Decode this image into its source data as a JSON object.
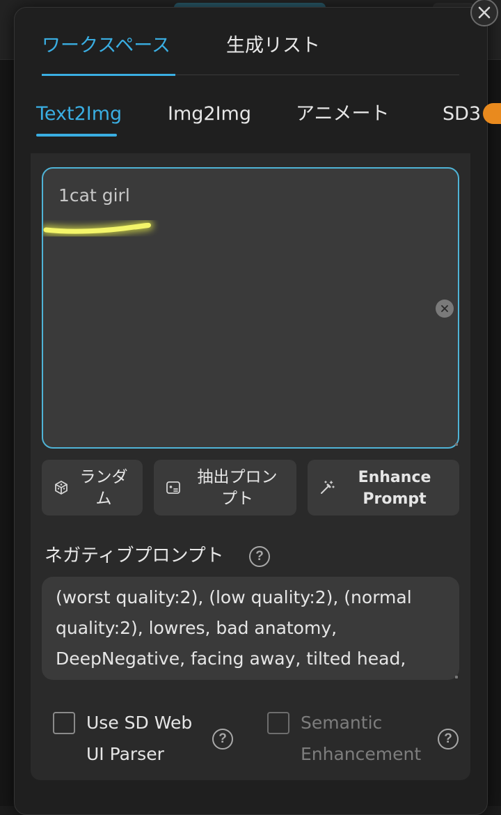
{
  "main_tabs": [
    {
      "label": "ワークスペース",
      "active": true
    },
    {
      "label": "生成リスト",
      "active": false
    }
  ],
  "mode_tabs": [
    {
      "label": "Text2Img",
      "active": true
    },
    {
      "label": "Img2Img",
      "active": false
    },
    {
      "label": "アニメート",
      "active": false
    },
    {
      "label": "SD3",
      "active": false
    }
  ],
  "prompt": {
    "value": "1cat girl"
  },
  "actions": {
    "random": {
      "line1": "ランダ",
      "line2": "ム",
      "icon": "dice-icon"
    },
    "extract": {
      "line1": "抽出プロン",
      "line2": "プト",
      "icon": "image-extract-icon"
    },
    "enhance": {
      "line1": "Enhance",
      "line2": "Prompt",
      "icon": "magic-wand-icon"
    }
  },
  "negative": {
    "title": "ネガティブプロンプト",
    "help": "?",
    "value_lines": [
      "(worst quality:2), (low quality:2), (normal",
      "quality:2), lowres, bad anatomy,",
      "DeepNegative, facing away, tilted head,"
    ]
  },
  "options": [
    {
      "line1": "Use SD Web",
      "line2": "UI Parser",
      "checked": false,
      "enabled": true,
      "help": "?"
    },
    {
      "line1": "Semantic",
      "line2": "Enhancement",
      "checked": false,
      "enabled": false,
      "help": "?"
    }
  ],
  "colors": {
    "accent": "#3aaee2",
    "highlight": "#f2f24a",
    "badge": "#e98a1e"
  }
}
